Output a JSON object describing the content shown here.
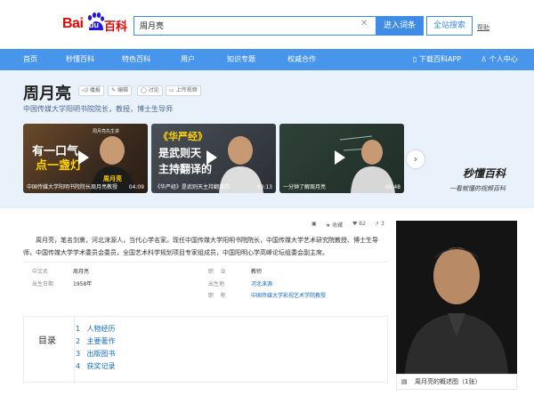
{
  "header": {
    "logo_bai": "Bai",
    "logo_du": "du",
    "logo_baike": "百科",
    "search_value": "周月亮",
    "enter_label": "进入词条",
    "search_all_label": "全站搜索",
    "help_label": "帮助"
  },
  "nav": {
    "items": [
      "首页",
      "秒懂百科",
      "特色百科",
      "用户",
      "知识专题",
      "权威合作"
    ],
    "download_label": "下载百科APP",
    "user_center_label": "个人中心"
  },
  "entry": {
    "title": "周月亮",
    "actions": [
      "播报",
      "编辑",
      "讨论",
      "上传视频"
    ],
    "subtitle": "中国传媒大学阳明书院院长，教授，博士生导师"
  },
  "videos": [
    {
      "caption": "中国传媒大学阳明书院院长周月亮教授",
      "duration": "04:09",
      "big_text_1": "有一口气",
      "big_text_2": "点一盏灯",
      "top_text": "周月亮先生讲",
      "bottom_right": "周月亮"
    },
    {
      "caption": "《华严经》是武则天主持翻译的",
      "duration": "03:13",
      "big_text_1": "《华严经》",
      "big_text_2": "是武则天",
      "big_text_3": "主持翻译的"
    },
    {
      "caption": "一分钟了解周月亮",
      "duration": "00:48"
    }
  ],
  "brand": {
    "name": "秒懂百科",
    "slogan": "一看就懂的视频百科"
  },
  "tools": {
    "collect_label": "收藏",
    "like_count": "82",
    "share_count": "3"
  },
  "intro": "周月亮，笔名剑熏，河北涞源人，当代心学名家。现任中国传媒大学阳明书院院长，中国传媒大学艺术研究院教授、博士生导师，中国传媒大学学术委员会委员，全国艺术科学规划项目专家组成员，中国阳明心学高峰论坛组委会副主席。",
  "basic_info": {
    "left": [
      {
        "label": "中文名",
        "value": "周月亮"
      },
      {
        "label": "出生日期",
        "value": "1958年"
      }
    ],
    "right": [
      {
        "label": "职    业",
        "value": "教师"
      },
      {
        "label": "出生地",
        "value": "河北涞源"
      },
      {
        "label": "职    称",
        "value": "中国传媒大学影视艺术学院教授"
      }
    ]
  },
  "toc": {
    "title": "目录",
    "items": [
      {
        "num": "1",
        "label": "人物经历"
      },
      {
        "num": "2",
        "label": "主要著作"
      },
      {
        "num": "3",
        "label": "出版图书"
      },
      {
        "num": "4",
        "label": "获奖记录"
      }
    ]
  },
  "photo": {
    "caption": "周月亮的概述图（1张）"
  },
  "colors": {
    "brand_red": "#e10602",
    "accent_blue": "#3e8ce5",
    "nav_blue": "#4895ec",
    "hero_bg": "#e9f1fb",
    "link_blue": "#136ec2"
  }
}
